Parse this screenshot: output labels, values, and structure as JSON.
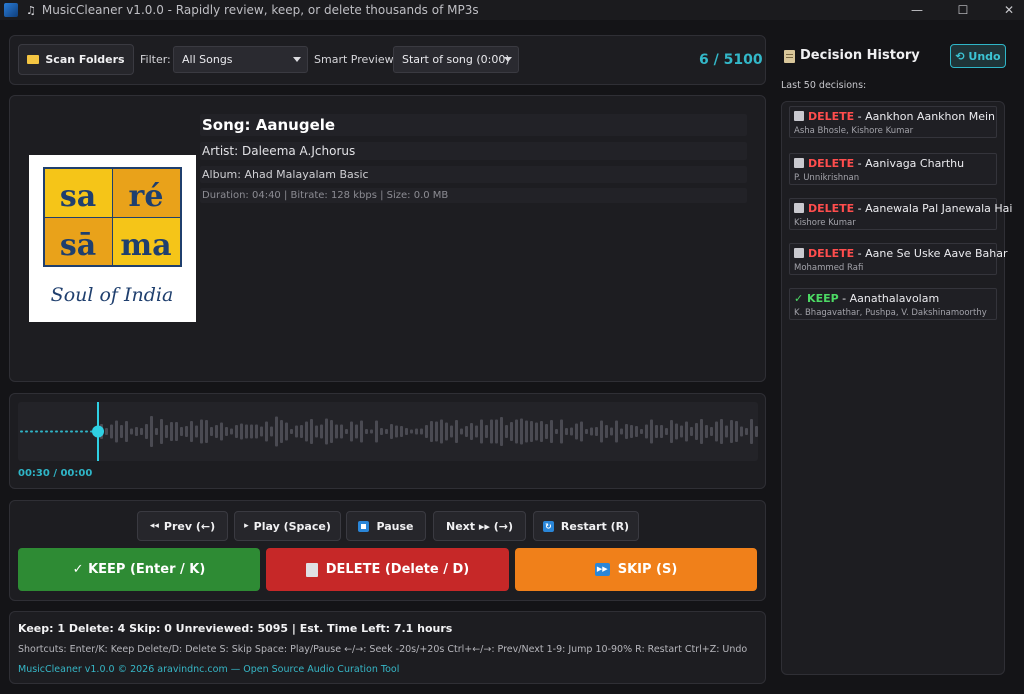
{
  "window": {
    "title": "MusicCleaner v1.0.0 - Rapidly review, keep, or delete thousands of MP3s",
    "minimize": "—",
    "maximize": "☐",
    "close": "✕"
  },
  "toolbar": {
    "scan_label": "Scan Folders",
    "filter_label": "Filter:",
    "filter_value": "All Songs",
    "preview_label": "Smart Preview:",
    "preview_value": "Start of song (0:00)",
    "counter": "6 / 5100"
  },
  "song": {
    "title": "Song: Aanugele",
    "artist": "Artist: Daleema A.Jchorus",
    "album": "Album: Ahad Malayalam Basic",
    "meta": "Duration: 04:40  |  Bitrate: 128 kbps  |  Size: 0.0 MB",
    "cover": {
      "row1": [
        "sa",
        "ré"
      ],
      "row2": [
        "sā",
        "ma"
      ],
      "tagline": "Soul of India"
    }
  },
  "waveform": {
    "time": "00:30 / 00:00",
    "progress": 0.108
  },
  "controls": {
    "prev": "Prev (←)",
    "play": "Play (Space)",
    "pause": "Pause",
    "next": "Next ▸▸ (→)",
    "restart": "Restart (R)",
    "keep": "✓ KEEP (Enter / K)",
    "delete": "DELETE (Delete / D)",
    "skip": "SKIP (S)"
  },
  "status": {
    "summary": "Keep: 1   Delete: 4   Skip: 0   Unreviewed: 5095   |   Est. Time Left: 7.1 hours",
    "shortcuts": "Shortcuts:  Enter/K: Keep   Delete/D: Delete   S: Skip   Space: Play/Pause   ←/→: Seek -20s/+20s   Ctrl+←/→: Prev/Next   1-9: Jump 10-90%   R: Restart   Ctrl+Z: Undo",
    "footer": "MusicCleaner v1.0.0 © 2026 aravindnc.com — Open Source Audio Curation Tool"
  },
  "history": {
    "title": "Decision History",
    "undo": "⟲ Undo",
    "subtitle": "Last 50 decisions:",
    "items": [
      {
        "action": "DELETE",
        "song": " - Aankhon Aankhon Mein",
        "artist": "Asha Bhosle, Kishore Kumar"
      },
      {
        "action": "DELETE",
        "song": " - Aanivaga Charthu",
        "artist": "P. Unnikrishnan"
      },
      {
        "action": "DELETE",
        "song": " - Aanewala Pal Janewala Hai",
        "artist": "Kishore Kumar"
      },
      {
        "action": "DELETE",
        "song": " - Aane Se Uske Aave Bahar",
        "artist": "Mohammed Rafi"
      },
      {
        "action": "✓ KEEP",
        "song": " - Aanathalavolam",
        "artist": "K. Bhagavathar, Pushpa, V. Dakshinamoorthy"
      }
    ]
  },
  "colors": {
    "accent": "#2fb6c8",
    "keep": "#2e8b34",
    "delete": "#c62828",
    "skip": "#f0801a"
  }
}
